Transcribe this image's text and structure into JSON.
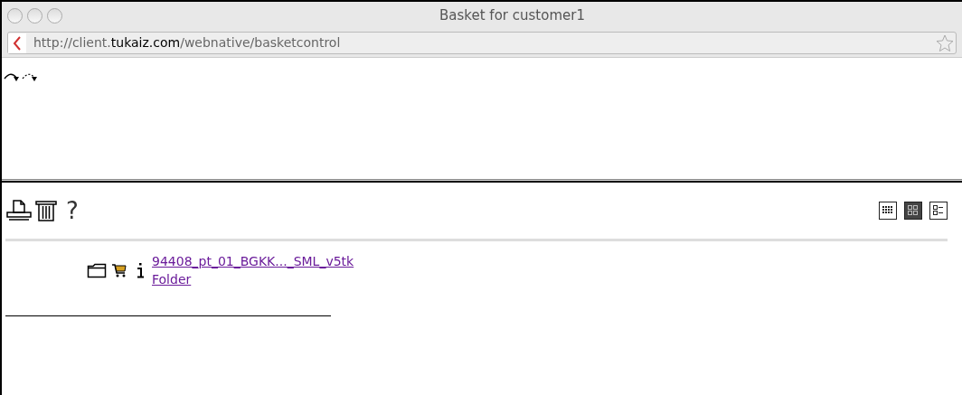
{
  "window": {
    "title": "Basket for customer1"
  },
  "address_bar": {
    "url": "http://client.**tukaiz.com**/webnative/basketcontrol"
  },
  "view_modes": [
    {
      "kind": "thumbs-small",
      "selected": false
    },
    {
      "kind": "thumbs-large",
      "selected": true
    },
    {
      "kind": "list",
      "selected": false
    }
  ],
  "items": [
    {
      "name": "94408_pt_01_BGKK..._SML_v5tk",
      "type": "Folder"
    }
  ],
  "help": "?"
}
